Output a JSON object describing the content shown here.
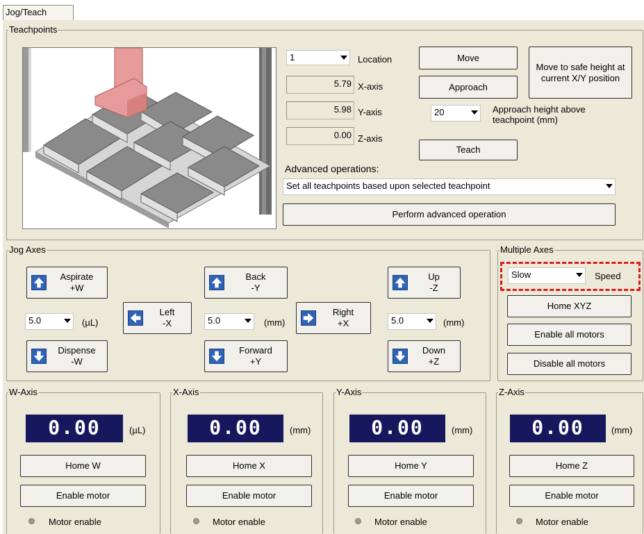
{
  "tab": {
    "label": "Jog/Teach"
  },
  "teachpoints": {
    "legend": "Teachpoints",
    "location": {
      "value": "1",
      "label": "Location"
    },
    "x_axis": {
      "value": "5.79",
      "label": "X-axis"
    },
    "y_axis": {
      "value": "5.98",
      "label": "Y-axis"
    },
    "z_axis": {
      "value": "0.00",
      "label": "Z-axis"
    },
    "move_label": "Move",
    "approach_label": "Approach",
    "teach_label": "Teach",
    "safe_height_label": "Move to safe height at current X/Y position",
    "approach_height": {
      "value": "20",
      "label": "Approach height above teachpoint (mm)"
    },
    "advanced_label": "Advanced operations:",
    "advanced_select": "Set all teachpoints based upon selected teachpoint",
    "perform_label": "Perform advanced operation"
  },
  "jog": {
    "legend": "Jog Axes",
    "aspirate": {
      "line1": "Aspirate",
      "line2": "+W"
    },
    "dispense": {
      "line1": "Dispense",
      "line2": "-W"
    },
    "left": {
      "line1": "Left",
      "line2": "-X"
    },
    "right": {
      "line1": "Right",
      "line2": "+X"
    },
    "back": {
      "line1": "Back",
      "line2": "-Y"
    },
    "forward": {
      "line1": "Forward",
      "line2": "+Y"
    },
    "up": {
      "line1": "Up",
      "line2": "-Z"
    },
    "down": {
      "line1": "Down",
      "line2": "+Z"
    },
    "w_step": {
      "value": "5.0",
      "unit": "(µL)"
    },
    "xy_step": {
      "value": "5.0",
      "unit": "(mm)"
    },
    "z_step": {
      "value": "5.0",
      "unit": "(mm)"
    }
  },
  "multi": {
    "legend": "Multiple Axes",
    "speed": {
      "value": "Slow",
      "label": "Speed"
    },
    "home_xyz": "Home XYZ",
    "enable_all": "Enable all motors",
    "disable_all": "Disable all motors"
  },
  "axes": [
    {
      "legend": "W-Axis",
      "value": "0.00",
      "unit": "(µL)",
      "home": "Home W",
      "enable": "Enable motor",
      "status": "Motor enable"
    },
    {
      "legend": "X-Axis",
      "value": "0.00",
      "unit": "(mm)",
      "home": "Home X",
      "enable": "Enable motor",
      "status": "Motor enable"
    },
    {
      "legend": "Y-Axis",
      "value": "0.00",
      "unit": "(mm)",
      "home": "Home Y",
      "enable": "Enable motor",
      "status": "Motor enable"
    },
    {
      "legend": "Z-Axis",
      "value": "0.00",
      "unit": "(mm)",
      "home": "Home Z",
      "enable": "Enable motor",
      "status": "Motor enable"
    }
  ],
  "colors": {
    "panel": "#ece9d8",
    "lcd": "#17175e",
    "jog_icon": "#2e63b6",
    "highlight": "#e01818"
  }
}
